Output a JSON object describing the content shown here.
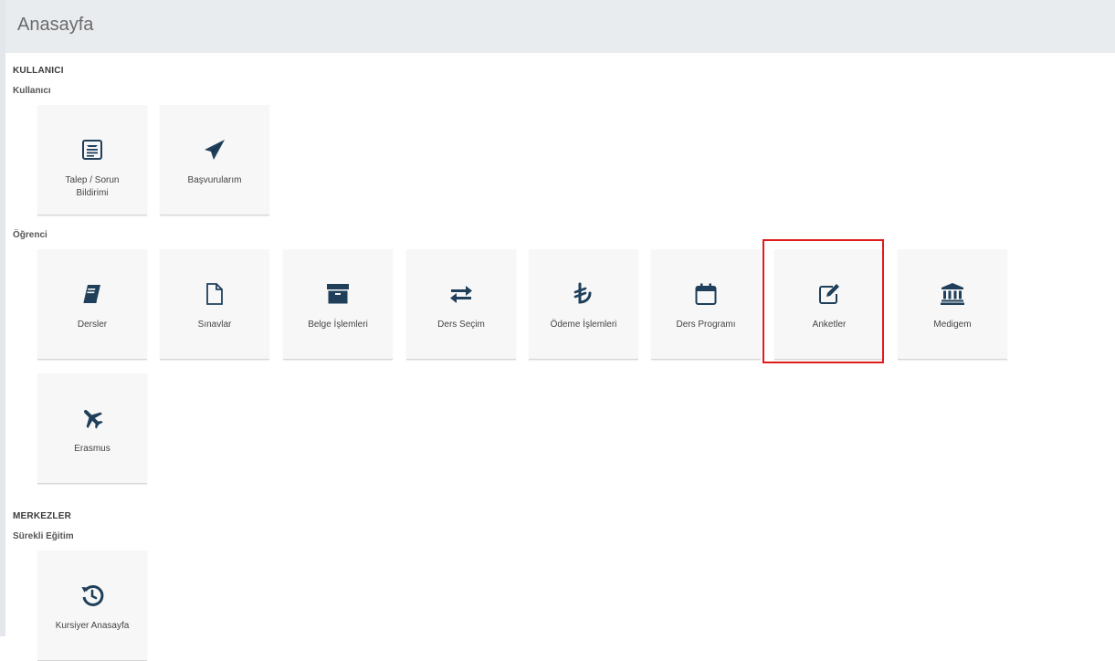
{
  "header": {
    "title": "Anasayfa"
  },
  "sections": [
    {
      "title": "KULLANICI",
      "groups": [
        {
          "title": "Kullanıcı",
          "tiles": [
            {
              "label_line1": "Talep / Sorun",
              "label_line2": "Bildirimi",
              "icon": "newspaper-icon"
            },
            {
              "label": "Başvurularım",
              "icon": "paper-plane-icon"
            }
          ]
        },
        {
          "title": "Öğrenci",
          "tiles": [
            {
              "label": "Dersler",
              "icon": "book-icon"
            },
            {
              "label": "Sınavlar",
              "icon": "file-icon"
            },
            {
              "label": "Belge İşlemleri",
              "icon": "archive-icon"
            },
            {
              "label": "Ders Seçim",
              "icon": "exchange-arrows-icon"
            },
            {
              "label": "Ödeme İşlemleri",
              "icon": "lira-sign-icon"
            },
            {
              "label": "Ders Programı",
              "icon": "calendar-icon"
            },
            {
              "label": "Anketler",
              "icon": "edit-icon"
            },
            {
              "label": "Medigem",
              "icon": "university-building-icon"
            },
            {
              "label": "Erasmus",
              "icon": "plane-icon"
            }
          ]
        }
      ]
    },
    {
      "title": "MERKEZLER",
      "groups": [
        {
          "title": "Sürekli Eğitim",
          "tiles": [
            {
              "label": "Kursiyer Anasayfa",
              "icon": "history-icon"
            }
          ]
        }
      ]
    }
  ],
  "colors": {
    "icon": "#1f3f5b",
    "highlight": "#e01b1b",
    "header_bg": "#e9ecef",
    "tile_bg": "#f7f7f7"
  }
}
